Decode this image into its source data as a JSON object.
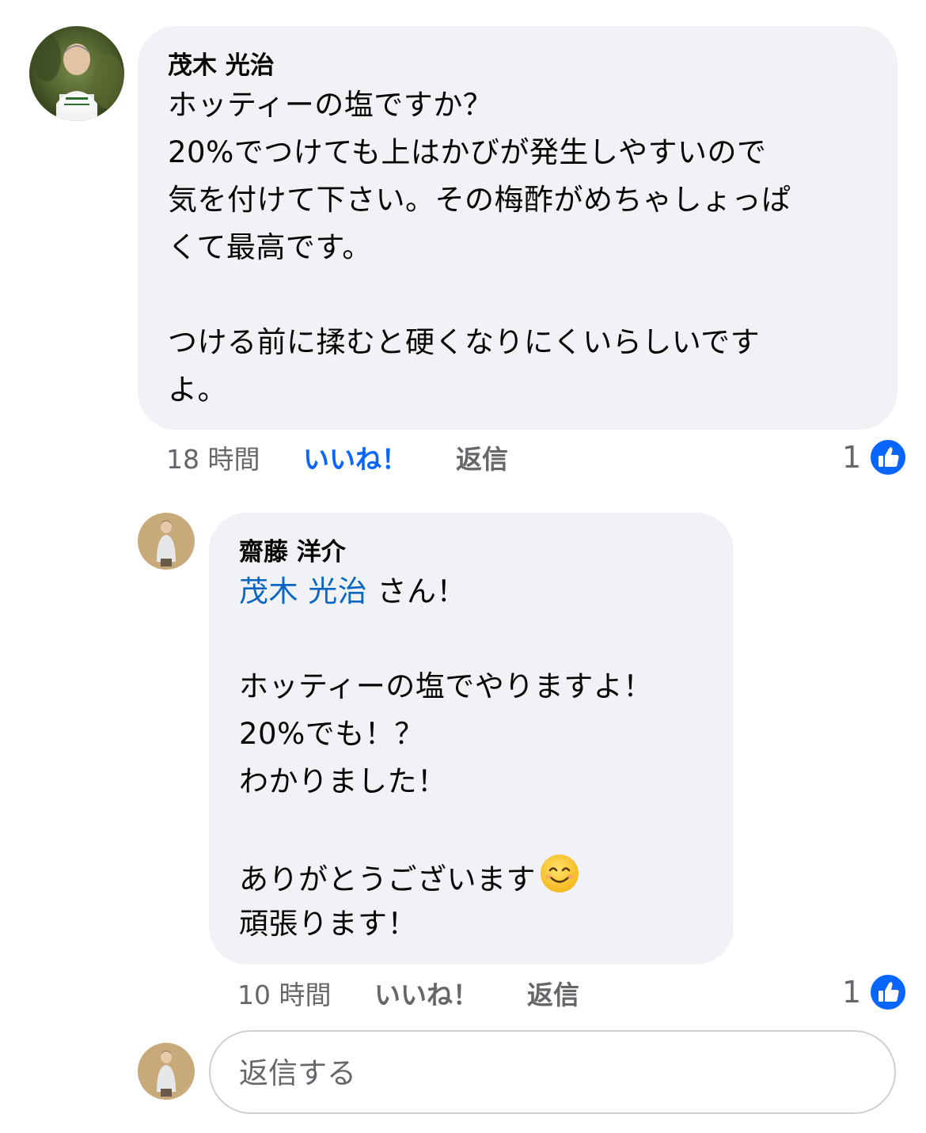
{
  "comment": {
    "author": "茂木 光治",
    "avatar_icon": "profile-photo-icon",
    "lines": [
      "ホッティーの塩ですか？",
      "20%でつけても上はかびが発生しやすいので",
      "気を付けて下さい。その梅酢がめちゃしょっぱ",
      "くて最高です。",
      "",
      "つける前に揉むと硬くなりにくいらしいです",
      "よ。"
    ],
    "time": "18 時間",
    "like_label": "いいね！",
    "reply_label": "返信",
    "reaction_count": "1",
    "reaction_icon": "thumbs-up-icon",
    "like_color": "#0866ff"
  },
  "reply": {
    "author": "齋藤 洋介",
    "avatar_icon": "profile-photo-icon",
    "mention": "茂木 光治",
    "mention_suffix": " さん！",
    "lines": [
      "",
      "ホッティーの塩でやりますよ！",
      "20%でも！？",
      "わかりました！",
      "",
      "ありがとうございます",
      "頑張ります！"
    ],
    "emoji_icon": "smiling-face-emoji-icon",
    "time": "10 時間",
    "like_label": "いいね！",
    "reply_label": "返信",
    "reaction_count": "1",
    "reaction_icon": "thumbs-up-icon"
  },
  "reply_input": {
    "placeholder": "返信する"
  },
  "colors": {
    "bubble_bg": "#f0f2f5",
    "mention": "#0a66c2",
    "meta_text": "#65676b",
    "reaction_blue": "#0866ff"
  }
}
